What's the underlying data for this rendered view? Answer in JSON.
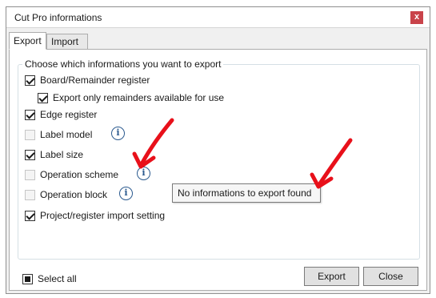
{
  "window": {
    "title": "Cut Pro informations",
    "close_glyph": "x"
  },
  "tabs": [
    {
      "label": "Export"
    },
    {
      "label": "Import"
    }
  ],
  "group": {
    "legend": "Choose which informations you want to export",
    "options": [
      {
        "label": "Board/Remainder register",
        "state": "checked"
      },
      {
        "label": "Export only remainders available for use",
        "state": "checked"
      },
      {
        "label": "Edge register",
        "state": "checked"
      },
      {
        "label": "Label model",
        "state": "disabled"
      },
      {
        "label": "Label size",
        "state": "checked"
      },
      {
        "label": "Operation scheme",
        "state": "disabled"
      },
      {
        "label": "Operation block",
        "state": "disabled"
      },
      {
        "label": "Project/register import setting",
        "state": "checked"
      }
    ]
  },
  "info_glyph": "i",
  "tooltip": {
    "text": "No informations to export found"
  },
  "footer": {
    "select_all_label": "Select all",
    "export_label": "Export",
    "close_label": "Close"
  },
  "colors": {
    "annotation_arrow": "#e8101a",
    "info_icon": "#2b5a8f",
    "close_button": "#c9434a"
  }
}
